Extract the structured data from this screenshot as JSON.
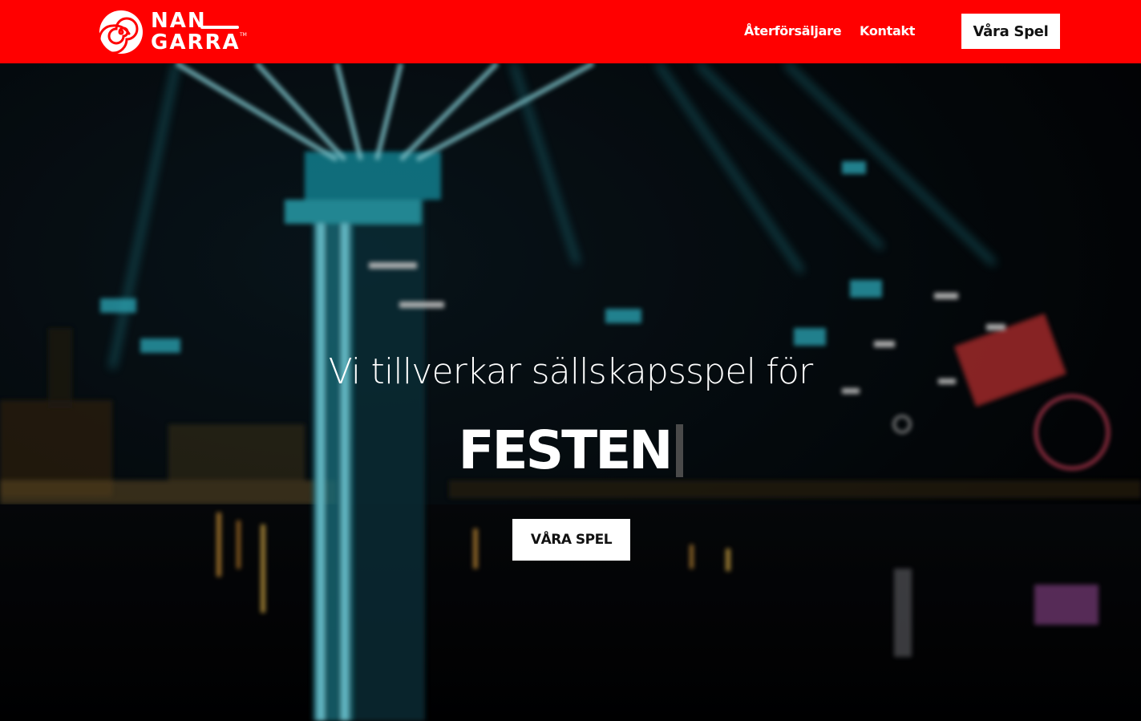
{
  "brand": {
    "logo_line1": "NAN",
    "logo_line2": "GARRA",
    "logo_tm": "TM",
    "color": "#ff0000"
  },
  "nav": {
    "links": [
      {
        "label": "Återförsäljare"
      },
      {
        "label": "Kontakt"
      }
    ],
    "cta_label": "Våra Spel"
  },
  "hero": {
    "title": "Vi tillverkar sällskapsspel för",
    "typed_word": "FESTEN",
    "button_label": "VÅRA SPEL",
    "background": "night-time amusement-park swing ride video still"
  }
}
